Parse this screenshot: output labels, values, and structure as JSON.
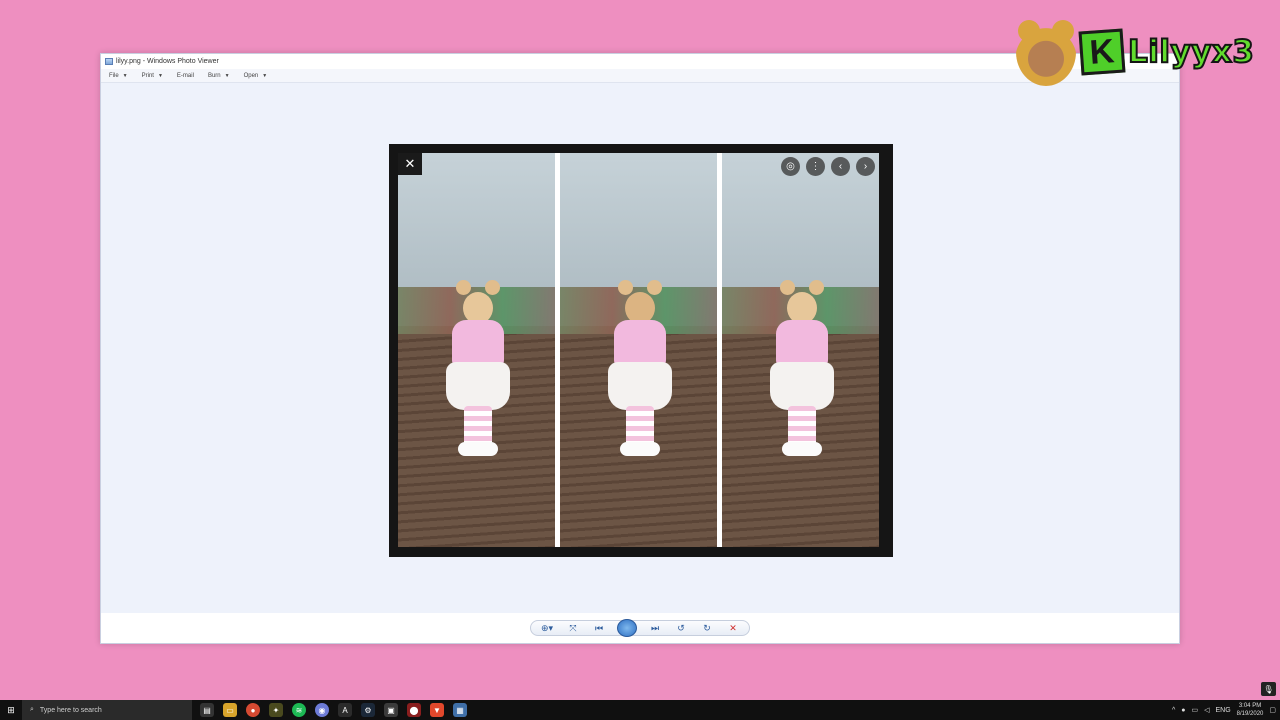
{
  "window": {
    "title": "lilyy.png - Windows Photo Viewer",
    "menu": [
      {
        "label": "File",
        "has_caret": true
      },
      {
        "label": "Print",
        "has_caret": true
      },
      {
        "label": "E-mail",
        "has_caret": false
      },
      {
        "label": "Burn",
        "has_caret": true
      },
      {
        "label": "Open",
        "has_caret": true
      }
    ]
  },
  "photo": {
    "panels": [
      "front-view",
      "back-view",
      "side-view"
    ],
    "overlay_close_icon": "close-icon",
    "overlay_actions": [
      "lens-icon",
      "more-icon",
      "prev-icon",
      "next-icon"
    ]
  },
  "toolbar": {
    "buttons": [
      "zoom-icon",
      "actual-size-icon",
      "previous-icon",
      "slideshow-icon",
      "next-icon",
      "rotate-left-icon",
      "rotate-right-icon",
      "delete-icon"
    ]
  },
  "brand": {
    "letter": "K",
    "name": "Lilyyx3"
  },
  "taskbar": {
    "search_placeholder": "Type here to search",
    "tray_lang": "ENG",
    "time": "3:04 PM",
    "date": "8/19/2020"
  },
  "colors": {
    "background": "#ee8fc0",
    "brand_green": "#62dc2e",
    "toolbar_accent": "#2c5b9c",
    "delete_red": "#d02c2c"
  }
}
